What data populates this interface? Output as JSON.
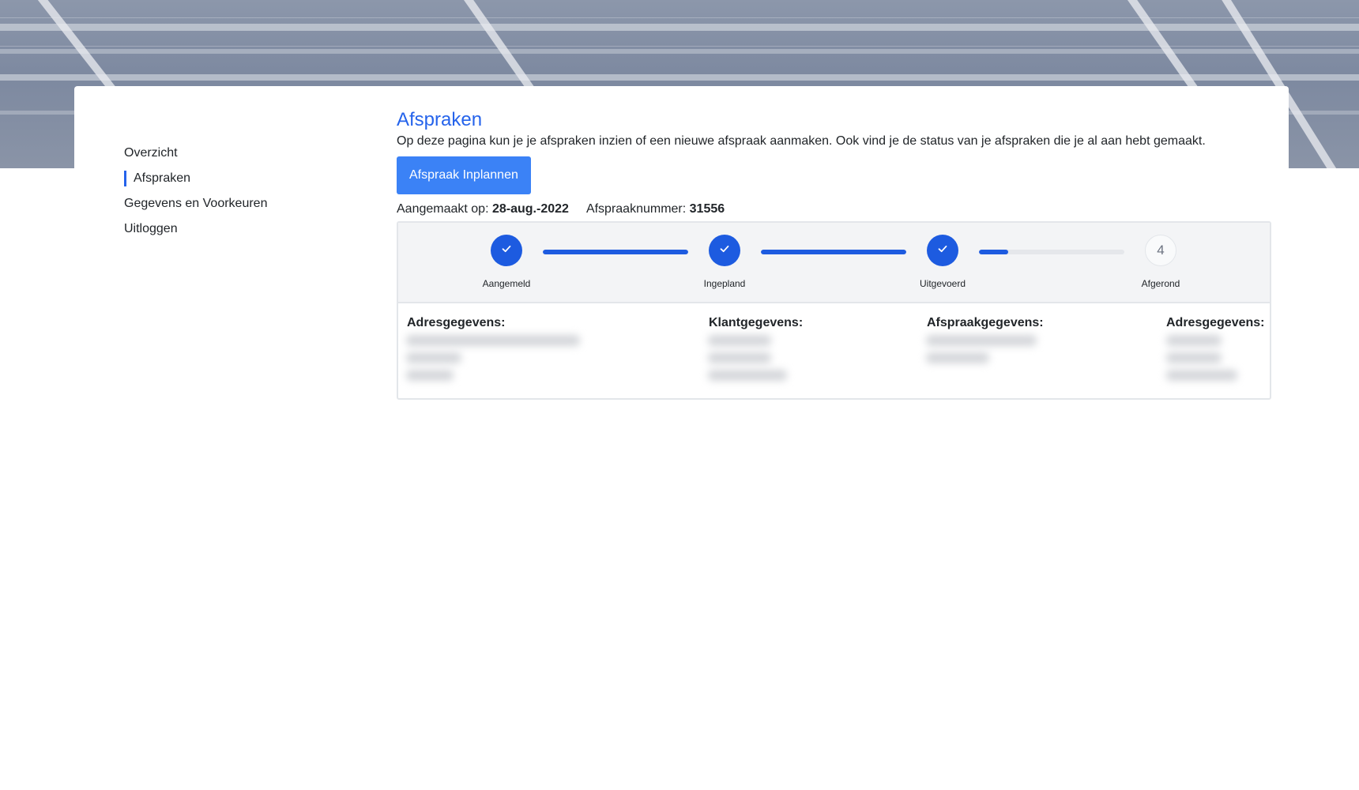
{
  "sidebar": {
    "items": [
      {
        "label": "Overzicht"
      },
      {
        "label": "Afspraken"
      },
      {
        "label": "Gegevens en Voorkeuren"
      },
      {
        "label": "Uitloggen"
      }
    ]
  },
  "main": {
    "title": "Afspraken",
    "description": "Op deze pagina kun je je afspraken inzien of een nieuwe afspraak aanmaken. Ook vind je de status van je afspraken die je al aan hebt gemaakt.",
    "schedule_button": "Afspraak Inplannen"
  },
  "appointment": {
    "created_label": "Aangemaakt op:",
    "created_value": "28-aug.-2022",
    "number_label": "Afspraaknummer:",
    "number_value": "31556",
    "steps": [
      {
        "label": "Aangemeld",
        "status": "done",
        "icon": "check-icon"
      },
      {
        "label": "Ingepland",
        "status": "done",
        "icon": "check-icon"
      },
      {
        "label": "Uitgevoerd",
        "status": "done",
        "icon": "check-icon"
      },
      {
        "label": "Afgerond",
        "status": "pending",
        "number": "4"
      }
    ],
    "progress": [
      1.0,
      1.0,
      0.2
    ],
    "columns": [
      {
        "heading": "Adresgegevens:"
      },
      {
        "heading": "Klantgegevens:"
      },
      {
        "heading": "Afspraakgegevens:"
      },
      {
        "heading": "Adresgegevens:"
      }
    ]
  },
  "colors": {
    "accent": "#2563eb",
    "step_done": "#1d5be0",
    "button": "#3b82f6"
  }
}
